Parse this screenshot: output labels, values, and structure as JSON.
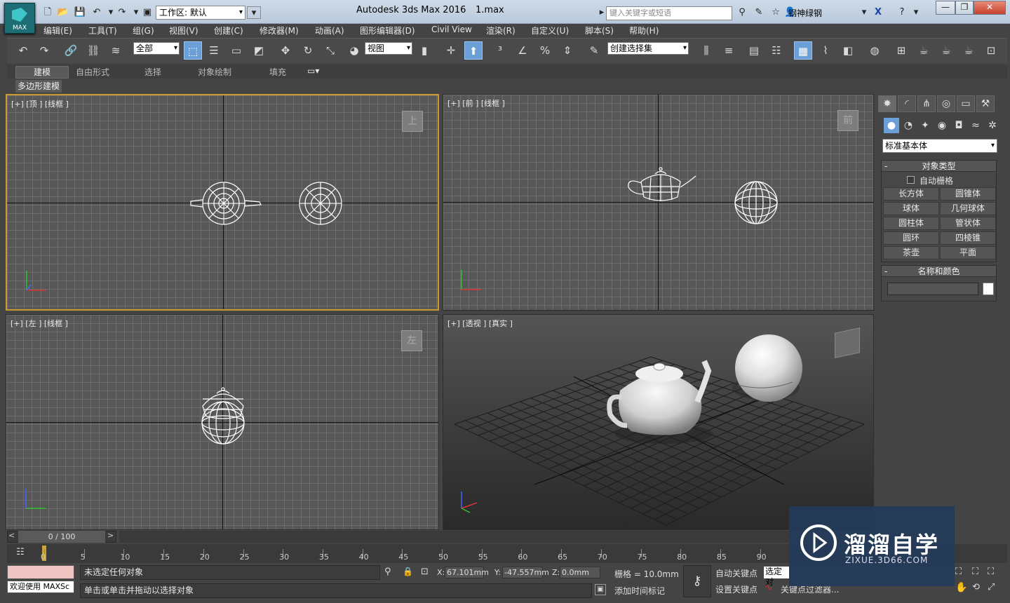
{
  "app": {
    "title": "Autodesk 3ds Max 2016",
    "filename": "1.max",
    "logo_text": "MAX"
  },
  "titlebar": {
    "workspace": "工作区: 默认",
    "search_placeholder": "键入关键字或短语",
    "user": "钢神绿钢"
  },
  "menu": [
    "编辑(E)",
    "工具(T)",
    "组(G)",
    "视图(V)",
    "创建(C)",
    "修改器(M)",
    "动画(A)",
    "图形编辑器(D)",
    "Civil View",
    "渲染(R)",
    "自定义(U)",
    "脚本(S)",
    "帮助(H)"
  ],
  "toolbar": {
    "filter": "全部",
    "ref_coord": "视图",
    "selection_set": "创建选择集"
  },
  "ribbon": {
    "tabs": [
      "建模",
      "自由形式",
      "选择",
      "对象绘制",
      "填充"
    ],
    "active_tab": "建模",
    "panel": "多边形建模"
  },
  "viewports": {
    "top": {
      "label": "[+] [顶 ] [线框 ]",
      "cube": "上"
    },
    "front": {
      "label": "[+] [前 ] [线框 ]",
      "cube": "前"
    },
    "left": {
      "label": "[+] [左 ] [线框 ]",
      "cube": "左"
    },
    "persp": {
      "label": "[+] [透视 ] [真实 ]"
    }
  },
  "command_panel": {
    "dropdown": "标准基本体",
    "object_type_title": "对象类型",
    "autogrid": "自动栅格",
    "buttons": [
      "长方体",
      "圆锥体",
      "球体",
      "几何球体",
      "圆柱体",
      "管状体",
      "圆环",
      "四棱锥",
      "茶壶",
      "平面"
    ],
    "name_color_title": "名称和颜色",
    "minus": "-"
  },
  "timeline": {
    "frame": "0 / 100",
    "ticks": [
      "0",
      "5",
      "10",
      "15",
      "20",
      "25",
      "30",
      "35",
      "40",
      "45",
      "50",
      "55",
      "60",
      "65",
      "70",
      "75",
      "80",
      "85",
      "90"
    ]
  },
  "status": {
    "selection": "未选定任何对象",
    "prompt": "单击或单击并拖动以选择对象",
    "welcome": "欢迎使用 MAXSc",
    "x_label": "X:",
    "x": "67.101mm",
    "y_label": "Y:",
    "y": "-47.557mm",
    "z_label": "Z:",
    "z": "0.0mm",
    "grid": "栅格 = 10.0mm",
    "add_time_tag": "添加时间标记",
    "auto_key": "自动关键点",
    "set_key": "设置关键点",
    "selected": "选定对",
    "key_filters": "关键点过滤器..."
  },
  "watermark": {
    "title": "溜溜自学",
    "url": "ZIXUE.3D66.COM"
  }
}
